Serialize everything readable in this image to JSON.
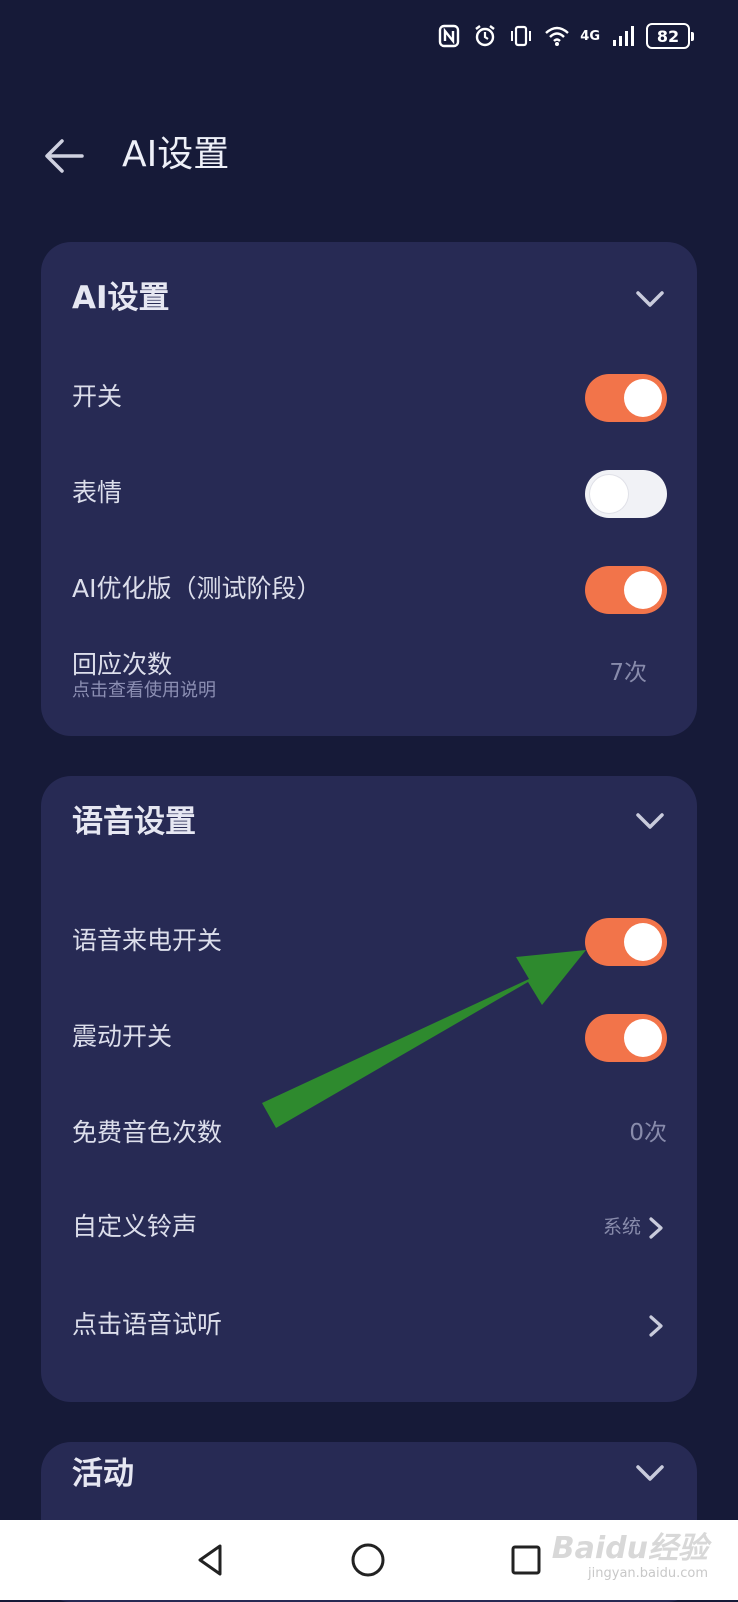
{
  "status_bar": {
    "network": "4G",
    "battery": "82"
  },
  "header": {
    "title": "AI设置"
  },
  "ai_card": {
    "title": "AI设置",
    "rows": [
      {
        "label": "开关",
        "toggle": true
      },
      {
        "label": "表情",
        "toggle": false
      },
      {
        "label": "AI优化版（测试阶段）",
        "toggle": true
      }
    ],
    "reply_count": {
      "label": "回应次数",
      "sublabel": "点击查看使用说明",
      "value": "7次"
    }
  },
  "voice_card": {
    "title": "语音设置",
    "rows": [
      {
        "label": "语音来电开关",
        "toggle": true
      },
      {
        "label": "震动开关",
        "toggle": true
      }
    ],
    "free_voice": {
      "label": "免费音色次数",
      "value": "0次"
    },
    "ringtone": {
      "label": "自定义铃声",
      "value": "系统"
    },
    "preview": {
      "label": "点击语音试听"
    }
  },
  "activity_card": {
    "title": "活动"
  },
  "watermark": {
    "logo": "Baidu经验",
    "url": "jingyan.baidu.com"
  },
  "colors": {
    "background": "#161a38",
    "card": "#272a54",
    "toggle_on": "#f2744a",
    "annotation_arrow": "#2e8a2e"
  }
}
